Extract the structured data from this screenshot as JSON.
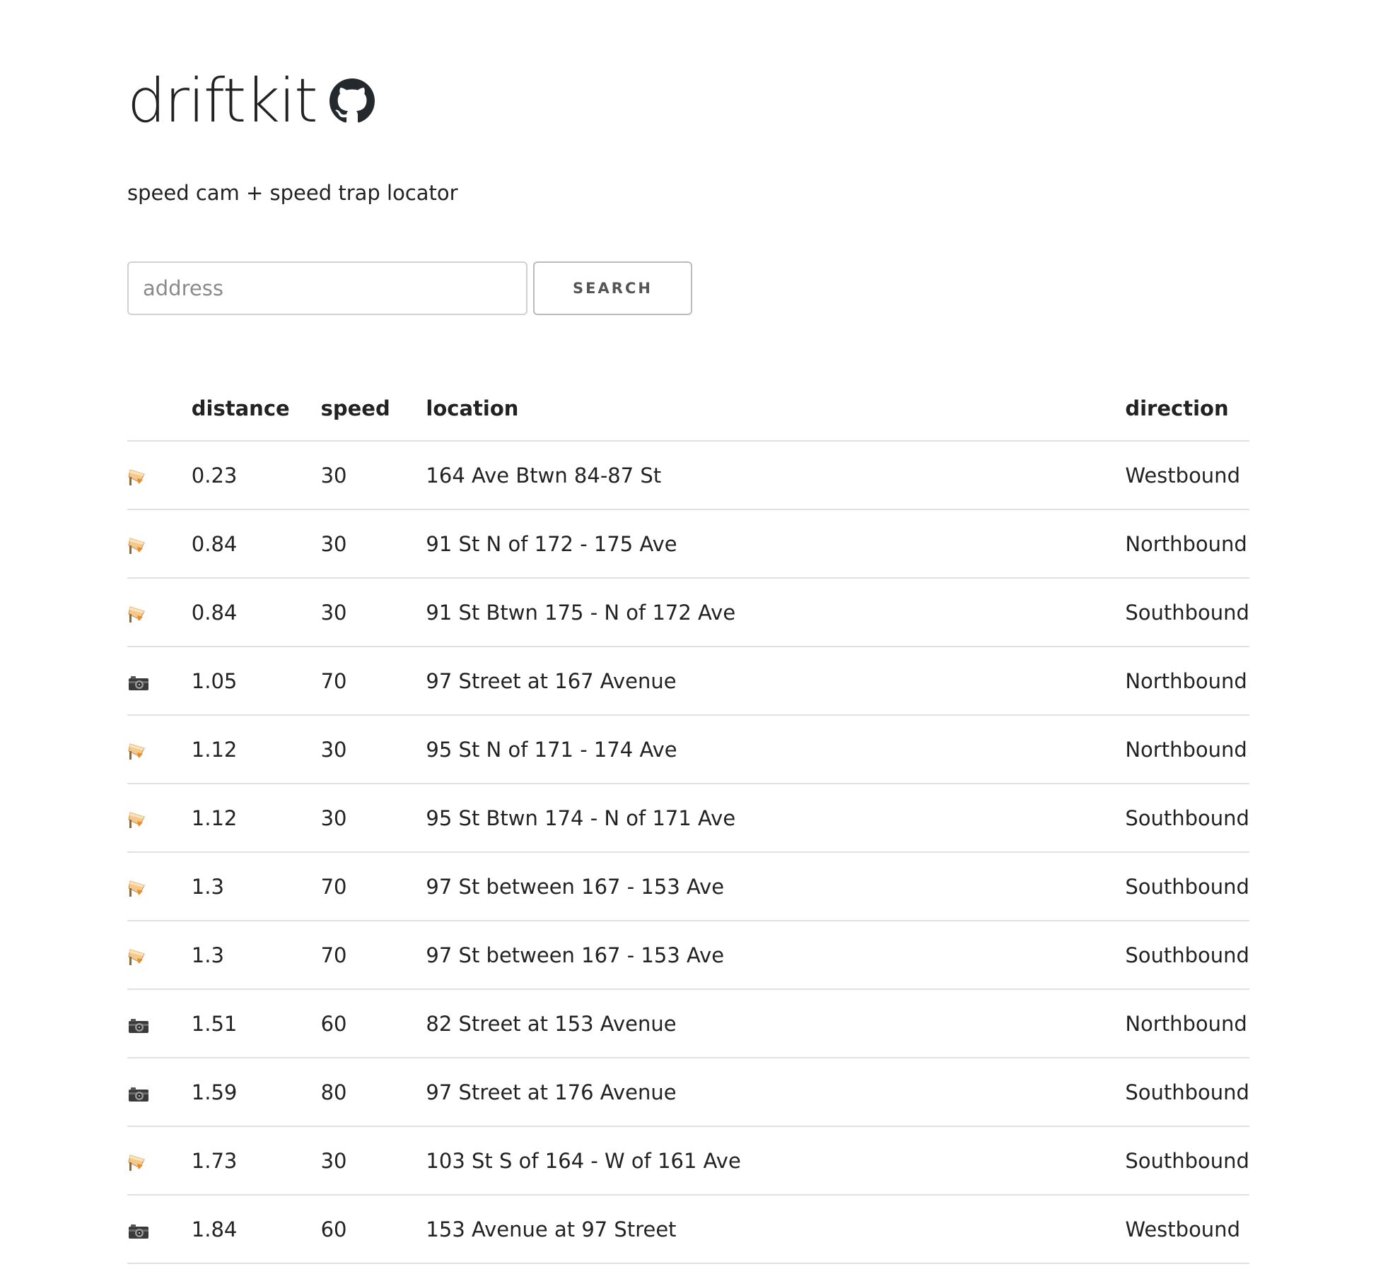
{
  "app": {
    "title": "driftkit",
    "subtitle": "speed cam + speed trap locator"
  },
  "search": {
    "placeholder": "address",
    "value": "",
    "button_label": "SEARCH"
  },
  "table": {
    "headers": [
      "",
      "distance",
      "speed",
      "location",
      "direction"
    ],
    "rows": [
      {
        "icon": "police-light-icon",
        "distance": "0.23",
        "speed": "30",
        "location": "164 Ave Btwn 84-87 St",
        "direction": "Westbound"
      },
      {
        "icon": "police-light-icon",
        "distance": "0.84",
        "speed": "30",
        "location": "91 St N of 172 - 175 Ave",
        "direction": "Northbound"
      },
      {
        "icon": "police-light-icon",
        "distance": "0.84",
        "speed": "30",
        "location": "91 St Btwn 175 - N of 172 Ave",
        "direction": "Southbound"
      },
      {
        "icon": "camera-icon",
        "distance": "1.05",
        "speed": "70",
        "location": "97 Street at 167 Avenue",
        "direction": "Northbound"
      },
      {
        "icon": "police-light-icon",
        "distance": "1.12",
        "speed": "30",
        "location": "95 St N of 171 - 174 Ave",
        "direction": "Northbound"
      },
      {
        "icon": "police-light-icon",
        "distance": "1.12",
        "speed": "30",
        "location": "95 St Btwn 174 - N of 171 Ave",
        "direction": "Southbound"
      },
      {
        "icon": "police-light-icon",
        "distance": "1.3",
        "speed": "70",
        "location": "97 St between 167 - 153 Ave",
        "direction": "Southbound"
      },
      {
        "icon": "police-light-icon",
        "distance": "1.3",
        "speed": "70",
        "location": "97 St between 167 - 153 Ave",
        "direction": "Southbound"
      },
      {
        "icon": "camera-icon",
        "distance": "1.51",
        "speed": "60",
        "location": "82 Street at 153 Avenue",
        "direction": "Northbound"
      },
      {
        "icon": "camera-icon",
        "distance": "1.59",
        "speed": "80",
        "location": "97 Street at 176 Avenue",
        "direction": "Southbound"
      },
      {
        "icon": "police-light-icon",
        "distance": "1.73",
        "speed": "30",
        "location": "103 St S of 164 - W of 161 Ave",
        "direction": "Southbound"
      },
      {
        "icon": "camera-icon",
        "distance": "1.84",
        "speed": "60",
        "location": "153 Avenue at 97 Street",
        "direction": "Westbound"
      }
    ]
  },
  "colors": {
    "text": "#222222",
    "border": "#e1e1e1",
    "button_text": "#555555"
  }
}
